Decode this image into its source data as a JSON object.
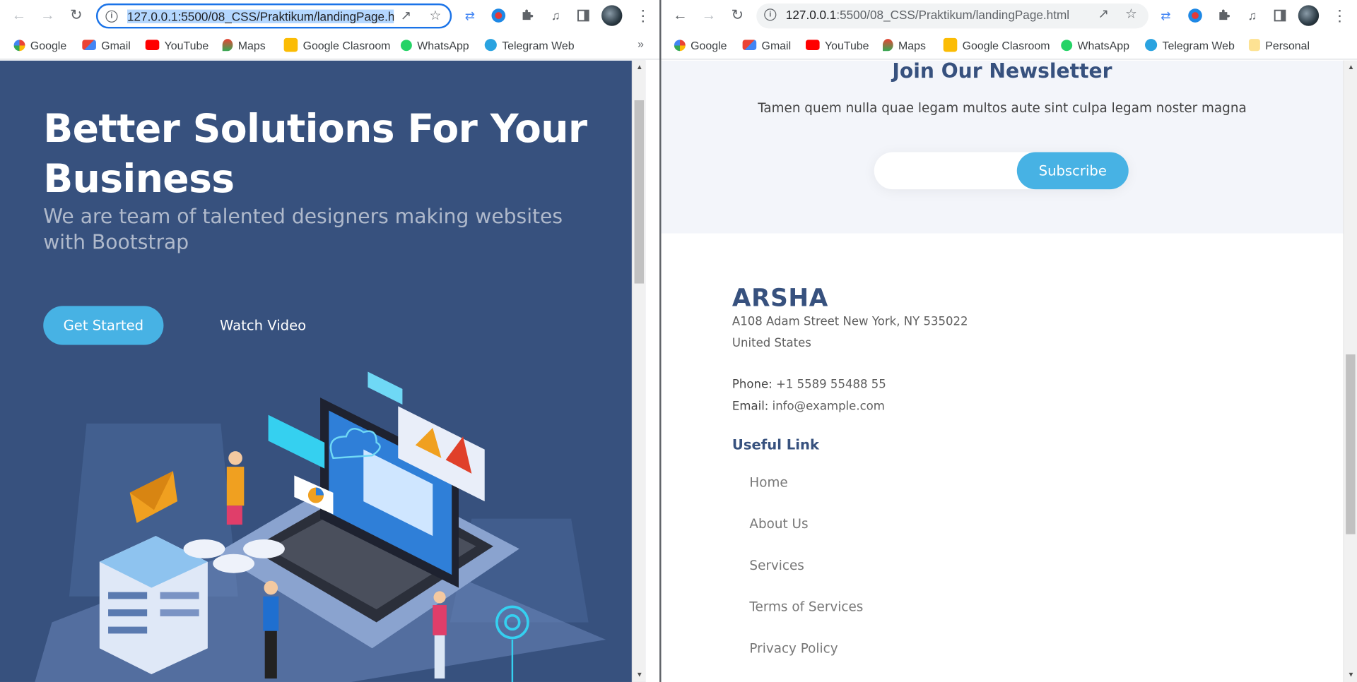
{
  "left_window": {
    "url_host": "127.0.0.1",
    "url_path": ":5500/08_CSS/Praktikum/landingPage.ht",
    "bookmarks": [
      "Google",
      "Gmail",
      "YouTube",
      "Maps",
      "Google Clasroom",
      "WhatsApp",
      "Telegram Web"
    ],
    "more_bookmarks": "»"
  },
  "right_window": {
    "url_host": "127.0.0.1",
    "url_path": ":5500/08_CSS/Praktikum/landingPage.html",
    "bookmarks": [
      "Google",
      "Gmail",
      "YouTube",
      "Maps",
      "Google Clasroom",
      "WhatsApp",
      "Telegram Web",
      "Personal"
    ]
  },
  "hero": {
    "title": "Better Solutions For Your Business",
    "subtitle": "We are team of talented designers making websites with Bootstrap",
    "get_started": "Get Started",
    "watch_video": "Watch Video"
  },
  "newsletter": {
    "title": "Join Our Newsletter",
    "text": "Tamen quem nulla quae legam multos aute sint culpa legam noster magna",
    "input_value": "",
    "subscribe": "Subscribe"
  },
  "footer": {
    "brand": "ARSHA",
    "address": "A108 Adam Street New York, NY 535022 United States",
    "phone_label": "Phone:",
    "phone": "+1 5589 55488 55",
    "email_label": "Email:",
    "email": "info@example.com",
    "links_title": "Useful Link",
    "links": [
      "Home",
      "About Us",
      "Services",
      "Terms of Services",
      "Privacy Policy"
    ]
  },
  "colors": {
    "hero_bg": "#37517e",
    "accent": "#47b2e4",
    "newsletter_bg": "#f3f5fa",
    "focus_ring": "#1a73e8"
  }
}
